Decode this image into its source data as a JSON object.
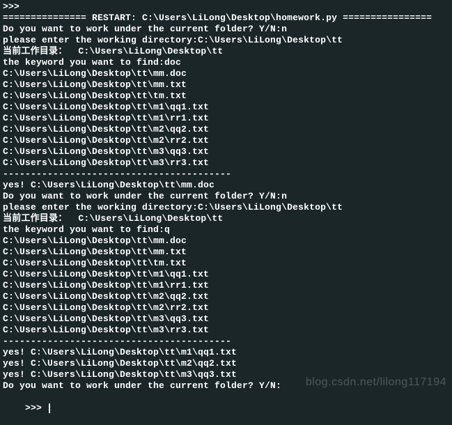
{
  "terminal": {
    "lines": [
      ">>>",
      "=============== RESTART: C:\\Users\\LiLong\\Desktop\\homework.py ================",
      "Do you want to work under the current folder? Y/N:n",
      "please enter the working directory:C:\\Users\\LiLong\\Desktop\\tt",
      "当前工作目录：  C:\\Users\\LiLong\\Desktop\\tt",
      "the keyword you want to find:doc",
      "C:\\Users\\LiLong\\Desktop\\tt\\mm.doc",
      "C:\\Users\\LiLong\\Desktop\\tt\\mm.txt",
      "C:\\Users\\LiLong\\Desktop\\tt\\tm.txt",
      "C:\\Users\\LiLong\\Desktop\\tt\\m1\\qq1.txt",
      "C:\\Users\\LiLong\\Desktop\\tt\\m1\\rr1.txt",
      "C:\\Users\\LiLong\\Desktop\\tt\\m2\\qq2.txt",
      "C:\\Users\\LiLong\\Desktop\\tt\\m2\\rr2.txt",
      "C:\\Users\\LiLong\\Desktop\\tt\\m3\\qq3.txt",
      "C:\\Users\\LiLong\\Desktop\\tt\\m3\\rr3.txt",
      "-----------------------------------------",
      "yes! C:\\Users\\LiLong\\Desktop\\tt\\mm.doc",
      "Do you want to work under the current folder? Y/N:n",
      "please enter the working directory:C:\\Users\\LiLong\\Desktop\\tt",
      "当前工作目录：  C:\\Users\\LiLong\\Desktop\\tt",
      "the keyword you want to find:q",
      "C:\\Users\\LiLong\\Desktop\\tt\\mm.doc",
      "C:\\Users\\LiLong\\Desktop\\tt\\mm.txt",
      "C:\\Users\\LiLong\\Desktop\\tt\\tm.txt",
      "C:\\Users\\LiLong\\Desktop\\tt\\m1\\qq1.txt",
      "C:\\Users\\LiLong\\Desktop\\tt\\m1\\rr1.txt",
      "C:\\Users\\LiLong\\Desktop\\tt\\m2\\qq2.txt",
      "C:\\Users\\LiLong\\Desktop\\tt\\m2\\rr2.txt",
      "C:\\Users\\LiLong\\Desktop\\tt\\m3\\qq3.txt",
      "C:\\Users\\LiLong\\Desktop\\tt\\m3\\rr3.txt",
      "-----------------------------------------",
      "yes! C:\\Users\\LiLong\\Desktop\\tt\\m1\\qq1.txt",
      "yes! C:\\Users\\LiLong\\Desktop\\tt\\m2\\qq2.txt",
      "yes! C:\\Users\\LiLong\\Desktop\\tt\\m3\\qq3.txt",
      "Do you want to work under the current folder? Y/N:"
    ],
    "prompt": ">>> "
  },
  "watermark": "blog.csdn.net/lilong117194"
}
